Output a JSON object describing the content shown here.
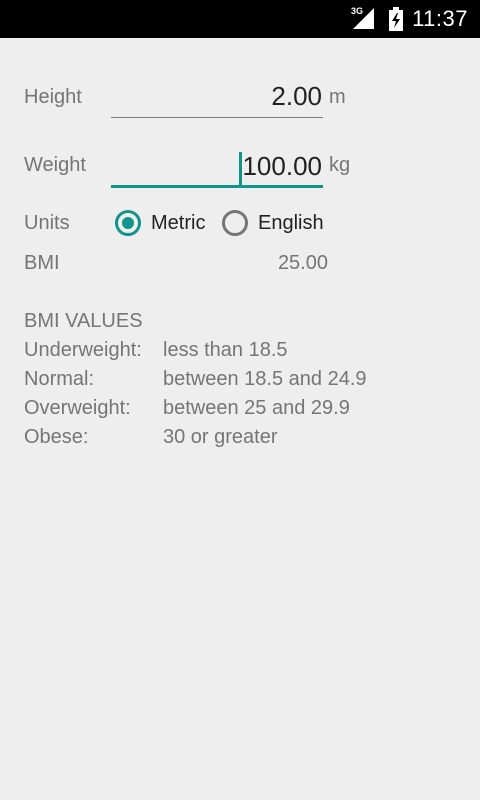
{
  "status_bar": {
    "network": "3G",
    "time": "11:37"
  },
  "form": {
    "height": {
      "label": "Height",
      "value": "2.00",
      "unit": "m"
    },
    "weight": {
      "label": "Weight",
      "value": "100.00",
      "unit": "kg"
    },
    "units": {
      "label": "Units",
      "options": [
        {
          "label": "Metric",
          "checked": true
        },
        {
          "label": "English",
          "checked": false
        }
      ]
    },
    "bmi": {
      "label": "BMI",
      "value": "25.00"
    }
  },
  "bmi_values": {
    "title": "BMI VALUES",
    "rows": [
      {
        "category": "Underweight:",
        "range": "less than 18.5"
      },
      {
        "category": "Normal:",
        "range": "between 18.5 and 24.9"
      },
      {
        "category": "Overweight:",
        "range": "between 25 and 29.9"
      },
      {
        "category": "Obese:",
        "range": "30 or greater"
      }
    ]
  },
  "colors": {
    "accent": "#10958a",
    "background": "#eeeeee",
    "status_bar": "#000000",
    "secondary_text": "#757575",
    "primary_text": "#222222"
  }
}
